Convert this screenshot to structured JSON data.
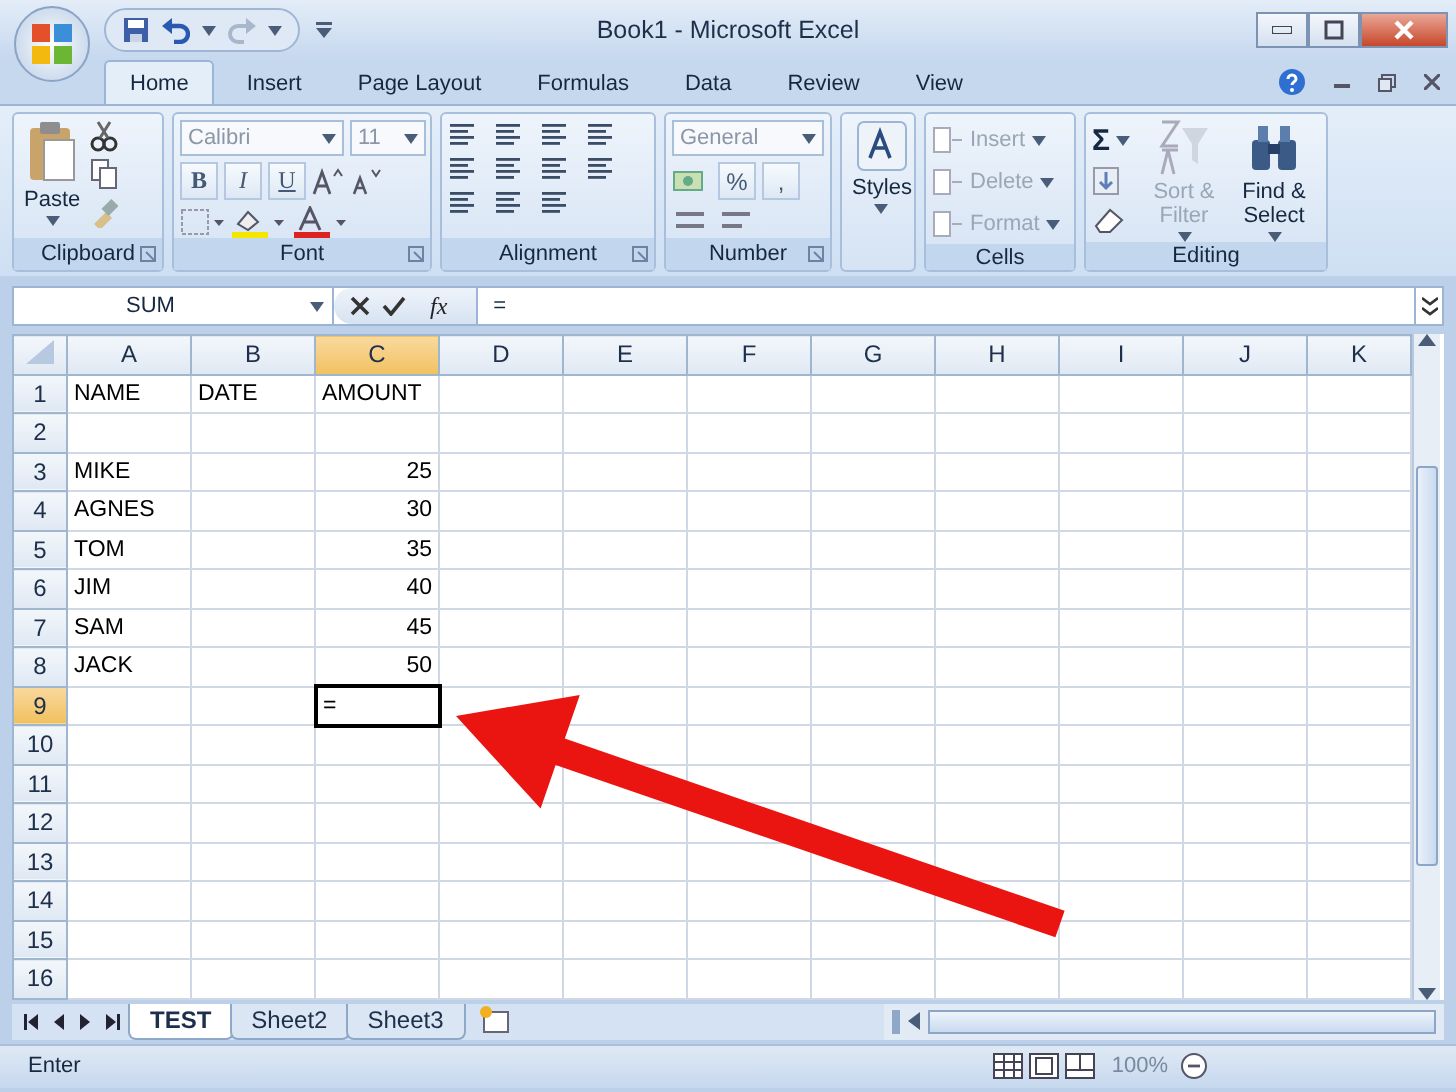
{
  "window": {
    "title": "Book1 - Microsoft Excel"
  },
  "ribbon": {
    "tabs": [
      {
        "label": "Home",
        "selected": true
      },
      {
        "label": "Insert",
        "selected": false
      },
      {
        "label": "Page Layout",
        "selected": false
      },
      {
        "label": "Formulas",
        "selected": false
      },
      {
        "label": "Data",
        "selected": false
      },
      {
        "label": "Review",
        "selected": false
      },
      {
        "label": "View",
        "selected": false
      }
    ],
    "groups": [
      {
        "kind": "clipboard",
        "label": "Clipboard",
        "paste": "Paste"
      },
      {
        "kind": "font",
        "label": "Font",
        "font_name": "Calibri",
        "font_size": "11",
        "buttons": [
          "B",
          "I",
          "U"
        ]
      },
      {
        "kind": "alignment",
        "label": "Alignment"
      },
      {
        "kind": "number",
        "label": "Number",
        "format": "General",
        "symbols": [
          "%",
          ","
        ]
      },
      {
        "kind": "styles",
        "label": "Styles"
      },
      {
        "kind": "cells",
        "label": "Cells",
        "items": [
          {
            "label": "Insert",
            "disabled": true
          },
          {
            "label": "Delete",
            "disabled": true
          },
          {
            "label": "Format",
            "disabled": true
          }
        ]
      },
      {
        "kind": "editing",
        "label": "Editing",
        "sum": "Σ",
        "items": [
          {
            "label": "Sort & Filter",
            "disabled": true
          },
          {
            "label": "Find & Select",
            "disabled": false
          }
        ]
      }
    ]
  },
  "formula_bar": {
    "name_box": "SUM",
    "fx": "fx",
    "value": "="
  },
  "sheet": {
    "columns": [
      {
        "label": "A",
        "selected": false
      },
      {
        "label": "B",
        "selected": false
      },
      {
        "label": "C",
        "selected": true
      },
      {
        "label": "D",
        "selected": false
      },
      {
        "label": "E",
        "selected": false
      },
      {
        "label": "F",
        "selected": false
      },
      {
        "label": "G",
        "selected": false
      },
      {
        "label": "H",
        "selected": false
      },
      {
        "label": "I",
        "selected": false
      },
      {
        "label": "J",
        "selected": false
      },
      {
        "label": "K",
        "selected": false
      }
    ],
    "rows": [
      {
        "label": "1",
        "selected": false,
        "cells": [
          {
            "text": "NAME",
            "kind": "text"
          },
          {
            "text": "DATE",
            "kind": "text"
          },
          {
            "text": "AMOUNT",
            "kind": "text"
          }
        ]
      },
      {
        "label": "2",
        "selected": false
      },
      {
        "label": "3",
        "selected": false,
        "cells": [
          {
            "text": "MIKE",
            "kind": "text"
          },
          null,
          {
            "text": "25",
            "kind": "number"
          }
        ]
      },
      {
        "label": "4",
        "selected": false,
        "cells": [
          {
            "text": "AGNES",
            "kind": "text"
          },
          null,
          {
            "text": "30",
            "kind": "number"
          }
        ]
      },
      {
        "label": "5",
        "selected": false,
        "cells": [
          {
            "text": "TOM",
            "kind": "text"
          },
          null,
          {
            "text": "35",
            "kind": "number"
          }
        ]
      },
      {
        "label": "6",
        "selected": false,
        "cells": [
          {
            "text": "JIM",
            "kind": "text"
          },
          null,
          {
            "text": "40",
            "kind": "number"
          }
        ]
      },
      {
        "label": "7",
        "selected": false,
        "cells": [
          {
            "text": "SAM",
            "kind": "text"
          },
          null,
          {
            "text": "45",
            "kind": "number"
          }
        ]
      },
      {
        "label": "8",
        "selected": false,
        "cells": [
          {
            "text": "JACK",
            "kind": "text"
          },
          null,
          {
            "text": "50",
            "kind": "number"
          }
        ]
      },
      {
        "label": "9",
        "selected": true,
        "cells": [
          null,
          null,
          {
            "text": "=",
            "kind": "text"
          }
        ]
      },
      {
        "label": "10",
        "selected": false
      },
      {
        "label": "11",
        "selected": false
      },
      {
        "label": "12",
        "selected": false
      },
      {
        "label": "13",
        "selected": false
      },
      {
        "label": "14",
        "selected": false
      },
      {
        "label": "15",
        "selected": false
      },
      {
        "label": "16",
        "selected": false
      }
    ]
  },
  "sheet_tabs": [
    {
      "label": "TEST",
      "selected": true
    },
    {
      "label": "Sheet2",
      "selected": false
    },
    {
      "label": "Sheet3",
      "selected": false
    }
  ],
  "status_bar": {
    "mode": "Enter",
    "zoom": "100%"
  }
}
